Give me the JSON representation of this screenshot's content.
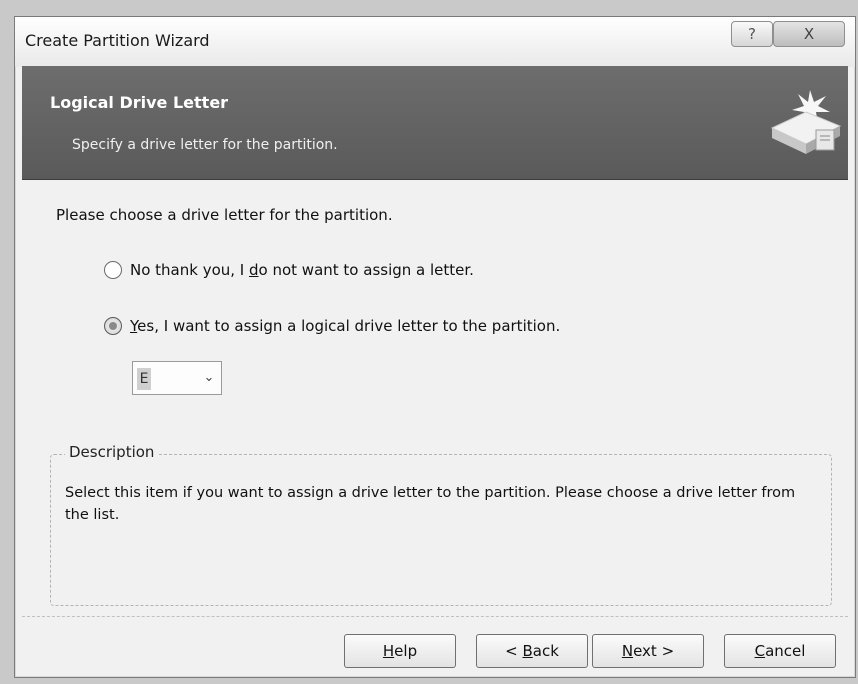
{
  "window": {
    "title": "Create Partition Wizard",
    "help_glyph": "?",
    "close_glyph": "X"
  },
  "header": {
    "title": "Logical Drive Letter",
    "subtitle": "Specify a drive letter for the partition."
  },
  "content": {
    "prompt": "Please choose a drive letter for the partition.",
    "options": [
      {
        "label_pre": "No thank you, I ",
        "mnemonic": "d",
        "label_post": "o not want to assign a letter.",
        "selected": false
      },
      {
        "label_pre": "",
        "mnemonic": "Y",
        "label_post": "es, I want to assign a logical drive letter to the partition.",
        "selected": true
      }
    ],
    "drive_select": {
      "value": "E",
      "arrow_glyph": "⌄"
    }
  },
  "description": {
    "legend": "Description",
    "text": "Select this item if you want to assign a drive letter to the partition. Please choose a drive letter from the list."
  },
  "buttons": {
    "help": {
      "mnemonic": "H",
      "rest": "elp"
    },
    "back": {
      "pre": "< ",
      "mnemonic": "B",
      "rest": "ack"
    },
    "next": {
      "mnemonic": "N",
      "rest": "ext >"
    },
    "cancel": {
      "mnemonic": "C",
      "rest": "ancel"
    }
  },
  "icons": {
    "wizard": "drive-wizard-icon"
  }
}
